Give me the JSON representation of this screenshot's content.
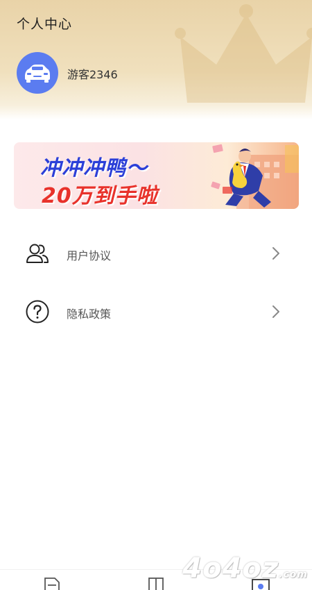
{
  "header": {
    "title": "个人中心",
    "user": {
      "name": "游客2346",
      "avatar_icon": "car-icon"
    }
  },
  "banner": {
    "line1": "冲冲冲鸭～",
    "line2": "20万到手啦"
  },
  "menu": [
    {
      "label": "用户协议",
      "icon": "users-icon"
    },
    {
      "label": "隐私政策",
      "icon": "question-circle-icon"
    }
  ],
  "bottom_nav": {
    "items": [
      {
        "icon": "document-icon"
      },
      {
        "icon": "book-icon"
      },
      {
        "icon": "profile-icon",
        "active": true
      }
    ]
  },
  "watermark": {
    "text": "4o4oz",
    "suffix": ".com"
  },
  "colors": {
    "accent": "#5b7cf0",
    "header_gold": "#e9d3a8",
    "banner_blue": "#2b3fd8",
    "banner_red": "#e8322b"
  }
}
